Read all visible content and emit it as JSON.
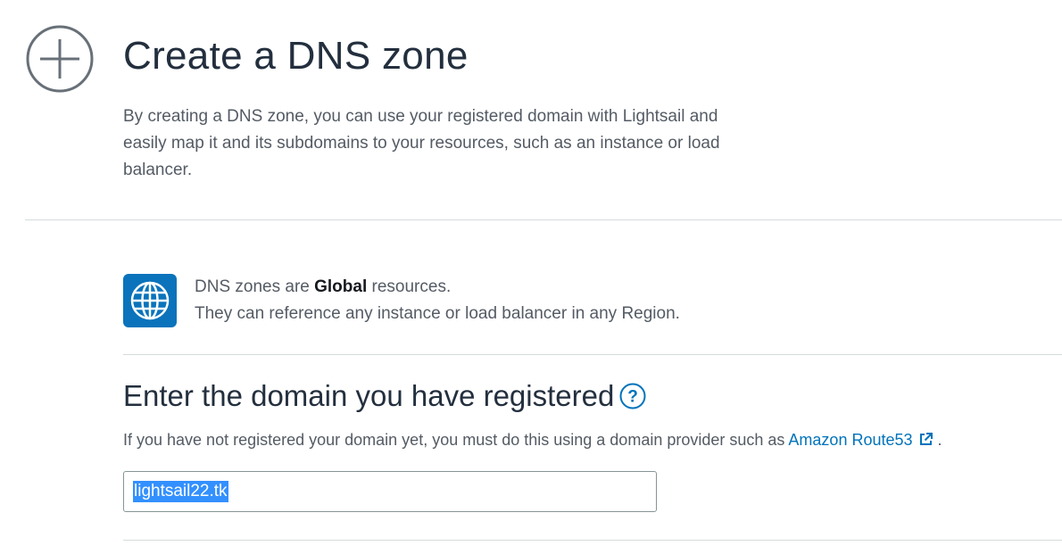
{
  "header": {
    "icon": "plus-circle-icon",
    "title": "Create a DNS zone",
    "intro": "By creating a DNS zone, you can use your registered domain with Lightsail and easily map it and its subdomains to your resources, such as an instance or load balancer."
  },
  "notice": {
    "icon": "globe-icon",
    "line1_prefix": "DNS zones are ",
    "line1_bold": "Global",
    "line1_suffix": " resources.",
    "line2": "They can reference any instance or load balancer in any Region."
  },
  "domain_section": {
    "title": "Enter the domain you have registered",
    "help_icon": "help-icon",
    "desc_prefix": "If you have not registered your domain yet, you must do this using a domain provider such as ",
    "link_label": "Amazon Route53",
    "link_icon": "external-link-icon",
    "desc_suffix": " .",
    "input_value": "lightsail22.tk"
  },
  "colors": {
    "accent": "#0073bb",
    "globe_bg": "#0a73bb",
    "selection": "#3390ff"
  }
}
